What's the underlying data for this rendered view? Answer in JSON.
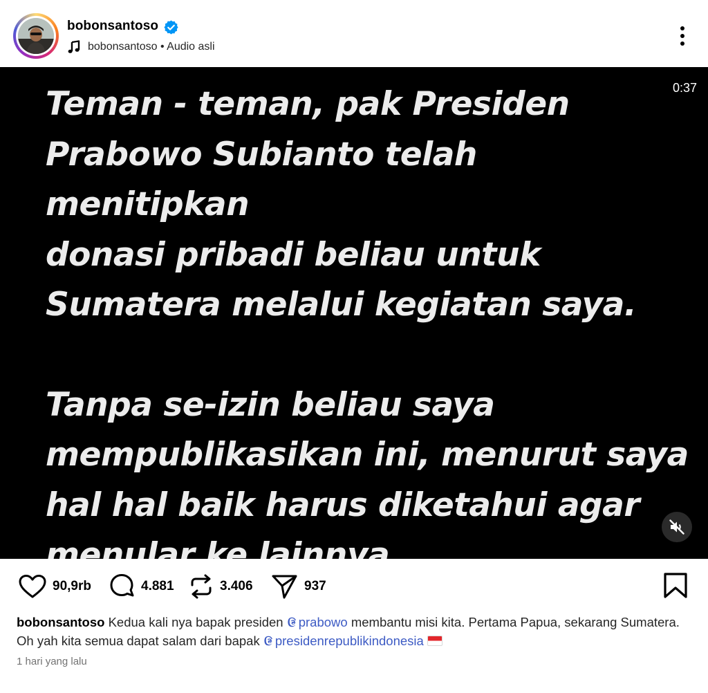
{
  "post": {
    "username": "bobonsantoso",
    "audio_label": "bobonsantoso • Audio asli"
  },
  "video": {
    "timecode": "0:37",
    "paragraph1_lines": [
      "Teman - teman, pak Presiden",
      "Prabowo Subianto telah menitipkan",
      "donasi pribadi beliau untuk",
      "Sumatera melalui kegiatan saya."
    ],
    "paragraph2_lines": [
      "Tanpa se-izin beliau saya",
      "mempublikasikan ini, menurut saya",
      "hal hal baik harus diketahui agar",
      "menular ke lainnya."
    ]
  },
  "actions": {
    "likes": "90,9rb",
    "comments": "4.881",
    "reposts": "3.406",
    "shares": "937"
  },
  "caption": {
    "username": "bobonsantoso",
    "text_1": "Kedua kali nya bapak presiden",
    "mention_1": "prabowo",
    "text_2": "membantu misi kita. Pertama Papua, sekarang Sumatera. Oh yah kita semua dapat salam dari bapak",
    "mention_2": "presidenrepublikindonesia"
  },
  "timestamp": "1 hari yang lalu",
  "colors": {
    "verified_badge": "#0095f6",
    "mention": "#3d5bc4",
    "video_bg": "#000000",
    "video_text": "#ececec"
  }
}
